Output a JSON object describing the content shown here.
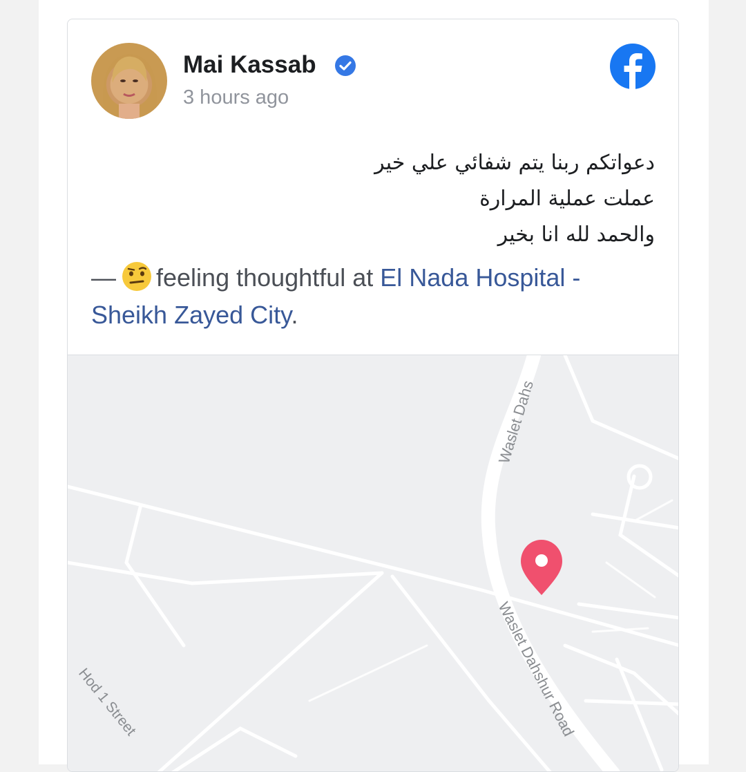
{
  "post": {
    "author": "Mai Kassab",
    "verified": true,
    "timestamp": "3 hours ago",
    "platform_icon": "facebook-logo-icon",
    "text_lines": [
      "دعواتكم ربنا يتم شفائي علي خير",
      "عملت عملية المرارة",
      "والحمد لله انا بخير"
    ],
    "activity": {
      "dash": "—",
      "emoji": "thinking-face-icon",
      "feeling": "feeling thoughtful at",
      "location": "El Nada Hospital - Sheikh Zayed City",
      "end": "."
    }
  },
  "map": {
    "labels": {
      "road_top": "Waslet Dahs",
      "road_main": "Waslet Dahshur Road",
      "street": "Hod 1 Street"
    },
    "pin_icon": "location-pin-icon",
    "pin_color": "#f0506e"
  },
  "colors": {
    "facebook_blue": "#1877f2",
    "link": "#385898",
    "verified": "#3578e5"
  }
}
